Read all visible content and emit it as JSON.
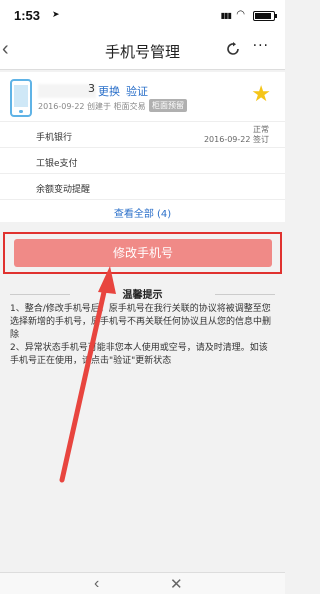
{
  "status_bar": {
    "time": "1:53",
    "signal": "▮▮▮",
    "wifi": "◠"
  },
  "nav": {
    "back_icon": "‹",
    "title": "手机号管理",
    "more_icon": "···"
  },
  "account": {
    "number_visible": "3",
    "change_label": "更换",
    "verify_label": "验证",
    "created_text": "2016-09-22 创建于 柜面交易",
    "badge_label": "柜面预留",
    "star_icon": "★"
  },
  "services": [
    {
      "label": "手机银行",
      "status": "正常",
      "date": "2016-09-22 签订"
    },
    {
      "label": "工银e支付",
      "status": "",
      "date": ""
    },
    {
      "label": "余额变动提醒",
      "status": "",
      "date": ""
    }
  ],
  "show_all_label": "查看全部 (4)",
  "modify_button_label": "修改手机号",
  "tips": {
    "title": "温馨提示",
    "item1": "1、整合/修改手机号后，原手机号在我行关联的协议将被调整至您选择新增的手机号，原手机号不再关联任何协议且从您的信息中删除",
    "item2": "2、异常状态手机号可能非您本人使用或空号，请及时清理。如该手机号正在使用，请点击\"验证\"更新状态"
  },
  "bottom_bar": {
    "back_icon": "‹",
    "close_icon": "✕"
  },
  "colors": {
    "link": "#2a6fc9",
    "button": "#f08a87",
    "highlight": "#e0322f",
    "star": "#f5c518"
  }
}
